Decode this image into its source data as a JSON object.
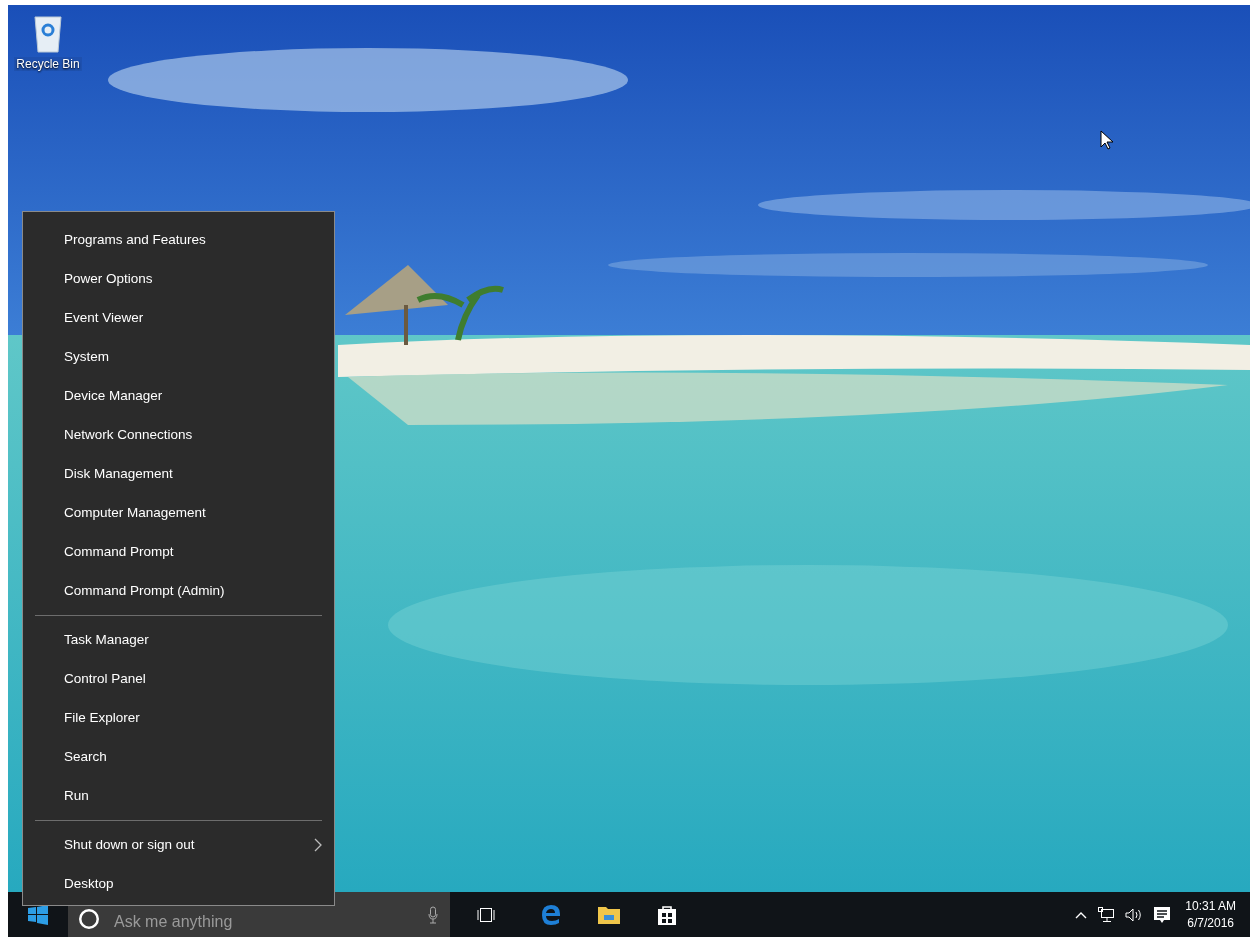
{
  "desktop_icons": [
    {
      "label": "Recycle Bin"
    }
  ],
  "context_menu": {
    "sections": [
      {
        "items": [
          {
            "label": "Programs and Features",
            "kind": "plain"
          },
          {
            "label": "Power Options",
            "kind": "plain"
          },
          {
            "label": "Event Viewer",
            "kind": "plain"
          },
          {
            "label": "System",
            "kind": "plain"
          },
          {
            "label": "Device Manager",
            "kind": "plain"
          },
          {
            "label": "Network Connections",
            "kind": "plain"
          },
          {
            "label": "Disk Management",
            "kind": "plain"
          },
          {
            "label": "Computer Management",
            "kind": "plain"
          },
          {
            "label": "Command Prompt",
            "kind": "plain"
          },
          {
            "label": "Command Prompt (Admin)",
            "kind": "plain"
          }
        ]
      },
      {
        "items": [
          {
            "label": "Task Manager",
            "kind": "plain"
          },
          {
            "label": "Control Panel",
            "kind": "plain"
          },
          {
            "label": "File Explorer",
            "kind": "plain"
          },
          {
            "label": "Search",
            "kind": "plain"
          },
          {
            "label": "Run",
            "kind": "plain"
          }
        ]
      },
      {
        "items": [
          {
            "label": "Shut down or sign out",
            "kind": "submenu"
          },
          {
            "label": "Desktop",
            "kind": "plain"
          }
        ]
      }
    ]
  },
  "taskbar": {
    "search": {
      "placeholder": "Ask me anything"
    },
    "clock": {
      "time": "10:31 AM",
      "date": "6/7/2016"
    }
  }
}
